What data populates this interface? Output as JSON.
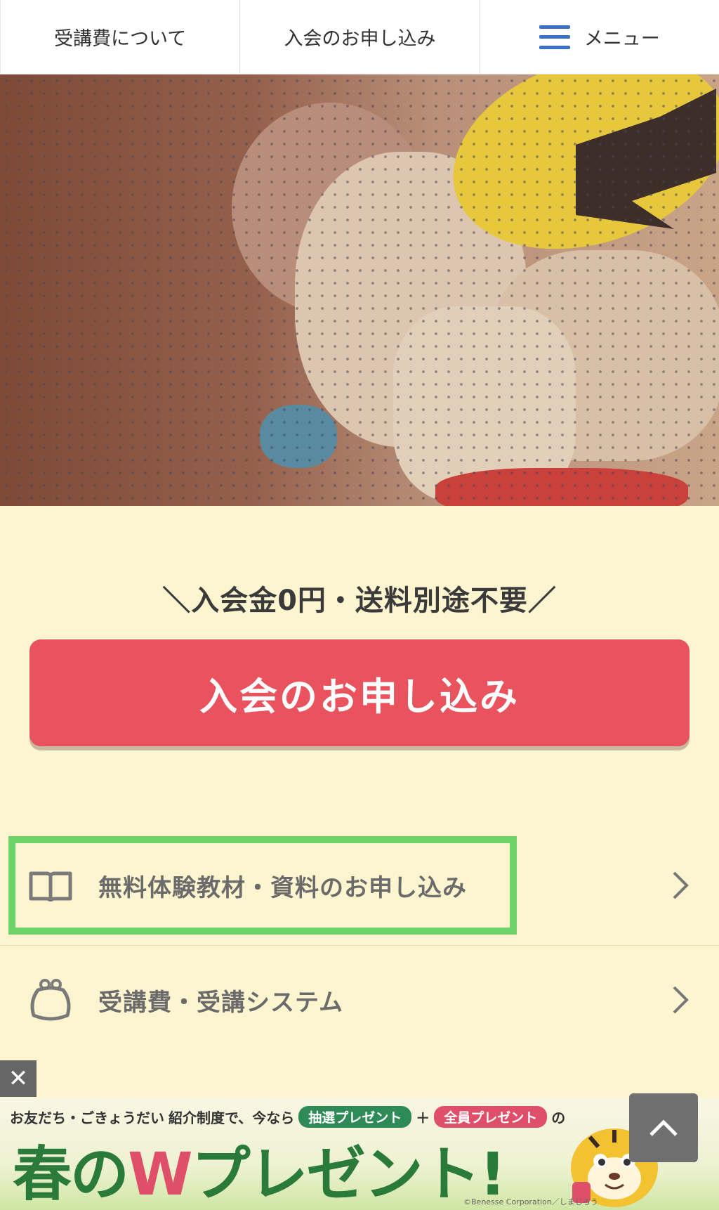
{
  "header": {
    "tabs": [
      {
        "label": "受講費について"
      },
      {
        "label": "入会のお申し込み"
      },
      {
        "label": "メニュー",
        "icon": "hamburger-icon"
      }
    ],
    "accent_color": "#3a70c8"
  },
  "hero": {
    "image": "photo-child-with-tiger-character"
  },
  "cta": {
    "promo": "＼入会金0円・送料別途不要／",
    "button_label": "入会のお申し込み",
    "button_color": "#e9535d"
  },
  "menu": {
    "items": [
      {
        "label": "無料体験教材・資料のお申し込み",
        "icon": "book-icon",
        "highlighted": true
      },
      {
        "label": "受講費・受講システム",
        "icon": "coin-purse-icon",
        "highlighted": false
      }
    ]
  },
  "banner": {
    "line1_prefix": "お友だち・ごきょうだい",
    "line1_mid": "紹介制度で、今なら",
    "pill1": "抽選プレゼント",
    "plus": "＋",
    "pill2": "全員プレゼント",
    "line1_suffix": "の",
    "headline_a": "春の",
    "headline_w": "W",
    "headline_b": "プレゼント!",
    "copyright": "©Benesse Corporation／しまじろう"
  },
  "controls": {
    "close_label": "✕"
  }
}
